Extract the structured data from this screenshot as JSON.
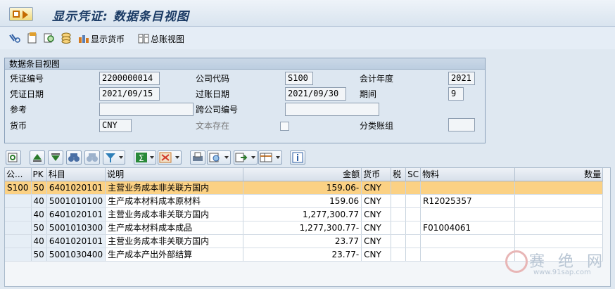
{
  "window": {
    "title": "显示凭证: 数据条目视图"
  },
  "toolbar": {
    "display_currency_label": "显示货币",
    "gl_view_label": "总账视图"
  },
  "header_group": {
    "title": "数据条目视图",
    "fields": {
      "doc_number": {
        "label": "凭证编号",
        "value": "2200000014"
      },
      "company_code": {
        "label": "公司代码",
        "value": "S100"
      },
      "fiscal_year": {
        "label": "会计年度",
        "value": "2021"
      },
      "doc_date": {
        "label": "凭证日期",
        "value": "2021/09/15"
      },
      "posting_date": {
        "label": "过账日期",
        "value": "2021/09/30"
      },
      "period": {
        "label": "期间",
        "value": "9"
      },
      "reference": {
        "label": "参考",
        "value": ""
      },
      "cross_cc": {
        "label": "跨公司编号",
        "value": ""
      },
      "currency": {
        "label": "货币",
        "value": "CNY"
      },
      "text_exists": {
        "label": "文本存在"
      },
      "ledger_group": {
        "label": "分类账组",
        "value": ""
      }
    }
  },
  "table": {
    "columns": [
      "公...",
      "PK",
      "科目",
      "说明",
      "金额",
      "货币",
      "税",
      "SC",
      "物料",
      "数量"
    ],
    "rows": [
      {
        "cc": "S100",
        "pk": "50",
        "account": "6401020101",
        "desc": "主营业务成本非关联方国内",
        "amount": "159.06-",
        "curr": "CNY",
        "tax": "",
        "sc": "",
        "material": "",
        "qty": ""
      },
      {
        "cc": "",
        "pk": "40",
        "account": "5001010100",
        "desc": "生产成本材料成本原材料",
        "amount": "159.06",
        "curr": "CNY",
        "tax": "",
        "sc": "",
        "material": "R12025357",
        "qty": ""
      },
      {
        "cc": "",
        "pk": "40",
        "account": "6401020101",
        "desc": "主营业务成本非关联方国内",
        "amount": "1,277,300.77",
        "curr": "CNY",
        "tax": "",
        "sc": "",
        "material": "",
        "qty": ""
      },
      {
        "cc": "",
        "pk": "50",
        "account": "5001010300",
        "desc": "生产成本材料成本成品",
        "amount": "1,277,300.77-",
        "curr": "CNY",
        "tax": "",
        "sc": "",
        "material": "F01004061",
        "qty": ""
      },
      {
        "cc": "",
        "pk": "40",
        "account": "6401020101",
        "desc": "主营业务成本非关联方国内",
        "amount": "23.77",
        "curr": "CNY",
        "tax": "",
        "sc": "",
        "material": "",
        "qty": ""
      },
      {
        "cc": "",
        "pk": "50",
        "account": "5001030400",
        "desc": "生产成本产出外部结算",
        "amount": "23.77-",
        "curr": "CNY",
        "tax": "",
        "sc": "",
        "material": "",
        "qty": ""
      }
    ]
  },
  "watermark": {
    "text": "赛 绝 网",
    "url": "www.91sap.com"
  },
  "colors": {
    "selected_row": "#fbd184",
    "title_text": "#1a3a64"
  }
}
